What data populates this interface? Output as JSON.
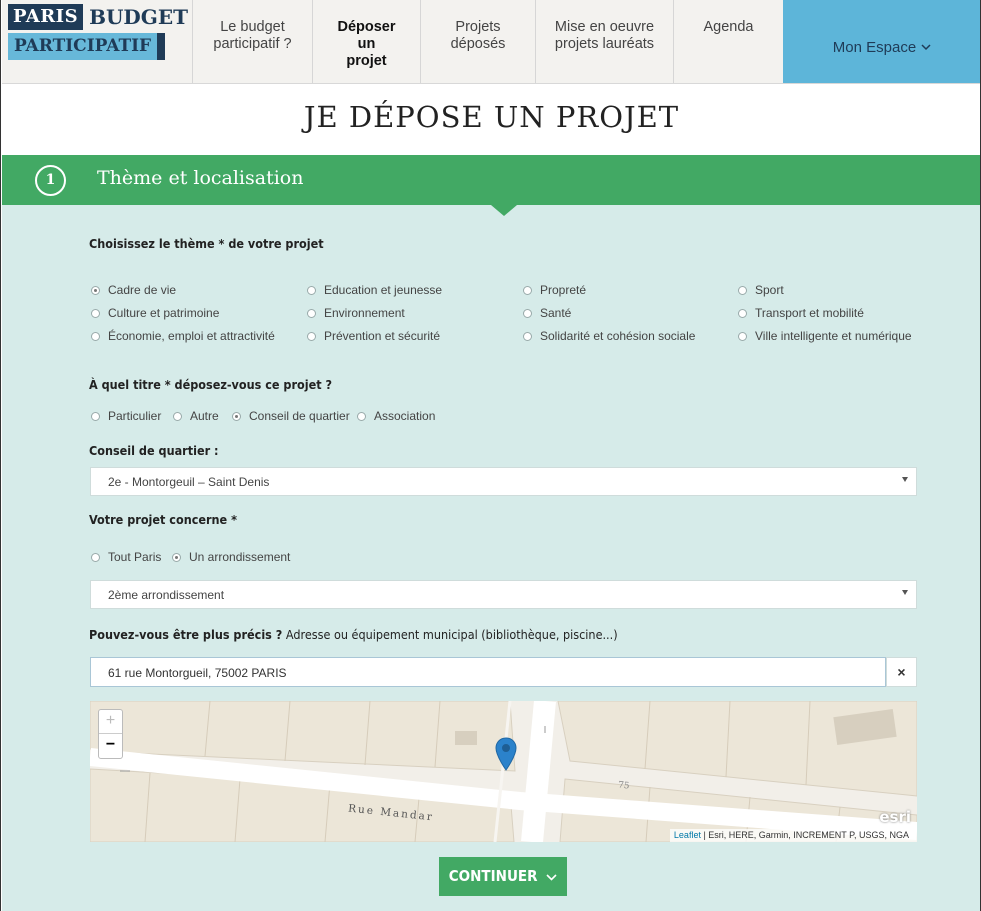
{
  "nav": {
    "logo": {
      "line1": "PARIS",
      "line1b": "BUDGET",
      "line2": "PARTICIPATIF"
    },
    "items": [
      {
        "label": "Le budget participatif ?"
      },
      {
        "label": "Déposer un projet"
      },
      {
        "label": "Projets déposés"
      },
      {
        "label": "Mise en oeuvre projets lauréats"
      },
      {
        "label": "Agenda"
      }
    ],
    "account": "Mon Espace",
    "colors": {
      "brand_blue": "#5db5d9",
      "navy": "#1f3b57",
      "green": "#42a964"
    }
  },
  "page_title": "JE DÉPOSE UN PROJET",
  "step": {
    "number": "1",
    "title": "Thème et localisation"
  },
  "form": {
    "theme_label": "Choisissez le thème * de votre projet",
    "themes": [
      {
        "label": "Cadre de vie",
        "selected": true
      },
      {
        "label": "Education et jeunesse",
        "selected": false
      },
      {
        "label": "Propreté",
        "selected": false
      },
      {
        "label": "Sport",
        "selected": false
      },
      {
        "label": "Culture et patrimoine",
        "selected": false
      },
      {
        "label": "Environnement",
        "selected": false
      },
      {
        "label": "Santé",
        "selected": false
      },
      {
        "label": "Transport et mobilité",
        "selected": false
      },
      {
        "label": "Économie, emploi et attractivité",
        "selected": false
      },
      {
        "label": "Prévention et sécurité",
        "selected": false
      },
      {
        "label": "Solidarité et cohésion sociale",
        "selected": false
      },
      {
        "label": "Ville intelligente et numérique",
        "selected": false
      }
    ],
    "role_label": "À quel titre * déposez-vous ce projet ?",
    "roles": [
      {
        "label": "Particulier",
        "selected": false
      },
      {
        "label": "Autre",
        "selected": false
      },
      {
        "label": "Conseil de quartier",
        "selected": true
      },
      {
        "label": "Association",
        "selected": false
      }
    ],
    "council_label": "Conseil de quartier :",
    "council_value": "2e - Montorgeuil – Saint Denis",
    "scope_label": "Votre projet concerne *",
    "scopes": [
      {
        "label": "Tout Paris",
        "selected": false
      },
      {
        "label": "Un arrondissement",
        "selected": true
      }
    ],
    "arrondissement_value": "2ème arrondissement",
    "precise_label_bold": "Pouvez-vous être plus précis ?",
    "precise_label_rest": " Adresse ou équipement municipal (bibliothèque, piscine...)",
    "address_value": "61 rue Montorgueil, 75002 PARIS",
    "clear_symbol": "×",
    "continue_label": "CONTINUER"
  },
  "map": {
    "zoom_in": "+",
    "zoom_out": "−",
    "street_name": "Rue Mandar",
    "number_label": "75",
    "attribution_link": "Leaflet",
    "attribution_rest": " | Esri, HERE, Garmin, INCREMENT P, USGS, NGA",
    "esri_mark": "esri",
    "marker_icon": "map-pin-icon"
  }
}
